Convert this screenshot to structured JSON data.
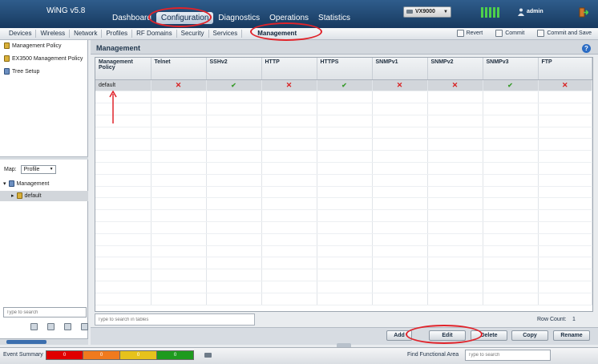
{
  "app": {
    "title": "WiNG v5.8"
  },
  "main_nav": [
    {
      "label": "Dashboard",
      "active": false
    },
    {
      "label": "Configuration",
      "active": true
    },
    {
      "label": "Diagnostics",
      "active": false
    },
    {
      "label": "Operations",
      "active": false
    },
    {
      "label": "Statistics",
      "active": false
    }
  ],
  "device": {
    "selected": "VX9000"
  },
  "user": {
    "name": "admin"
  },
  "sub_nav": [
    {
      "label": "Devices",
      "active": false
    },
    {
      "label": "Wireless",
      "active": false
    },
    {
      "label": "Network",
      "active": false
    },
    {
      "label": "Profiles",
      "active": false
    },
    {
      "label": "RF Domains",
      "active": false
    },
    {
      "label": "Security",
      "active": false
    },
    {
      "label": "Services",
      "active": false
    },
    {
      "label": "Management",
      "active": true
    }
  ],
  "actions": {
    "revert": "Revert",
    "commit": "Commit",
    "commit_save": "Commit and Save"
  },
  "left_panel": {
    "tree": [
      {
        "label": "Management Policy",
        "icon": "policy-icon"
      },
      {
        "label": "EX3500 Management Policy",
        "icon": "policy-icon"
      },
      {
        "label": "Tree Setup",
        "icon": "tree-icon"
      }
    ],
    "map_label": "Map:",
    "map_value": "Profile",
    "map_tree": {
      "root": "Management",
      "child": "default"
    },
    "search_placeholder": "Type to search"
  },
  "main": {
    "title": "Management",
    "columns": [
      "Management Policy",
      "Telnet",
      "SSHv2",
      "HTTP",
      "HTTPS",
      "SNMPv1",
      "SNMPv2",
      "SNMPv3",
      "FTP"
    ],
    "rows": [
      {
        "name": "default",
        "values": [
          "x",
          "ok",
          "x",
          "ok",
          "x",
          "x",
          "ok",
          "x"
        ]
      }
    ],
    "search_placeholder": "Type to search in tables",
    "row_count_label": "Row Count:",
    "row_count": "1"
  },
  "buttons": {
    "add": "Add",
    "edit": "Edit",
    "delete": "Delete",
    "copy": "Copy",
    "rename": "Rename"
  },
  "status_bar": {
    "event_summary": "Event Summary",
    "counts": [
      {
        "value": "0",
        "color": "#e00000"
      },
      {
        "value": "0",
        "color": "#f07a1e"
      },
      {
        "value": "0",
        "color": "#e6c21c"
      },
      {
        "value": "0",
        "color": "#1e9a1e"
      }
    ],
    "find_label": "Find Functional Area",
    "find_placeholder": "Type to search"
  }
}
